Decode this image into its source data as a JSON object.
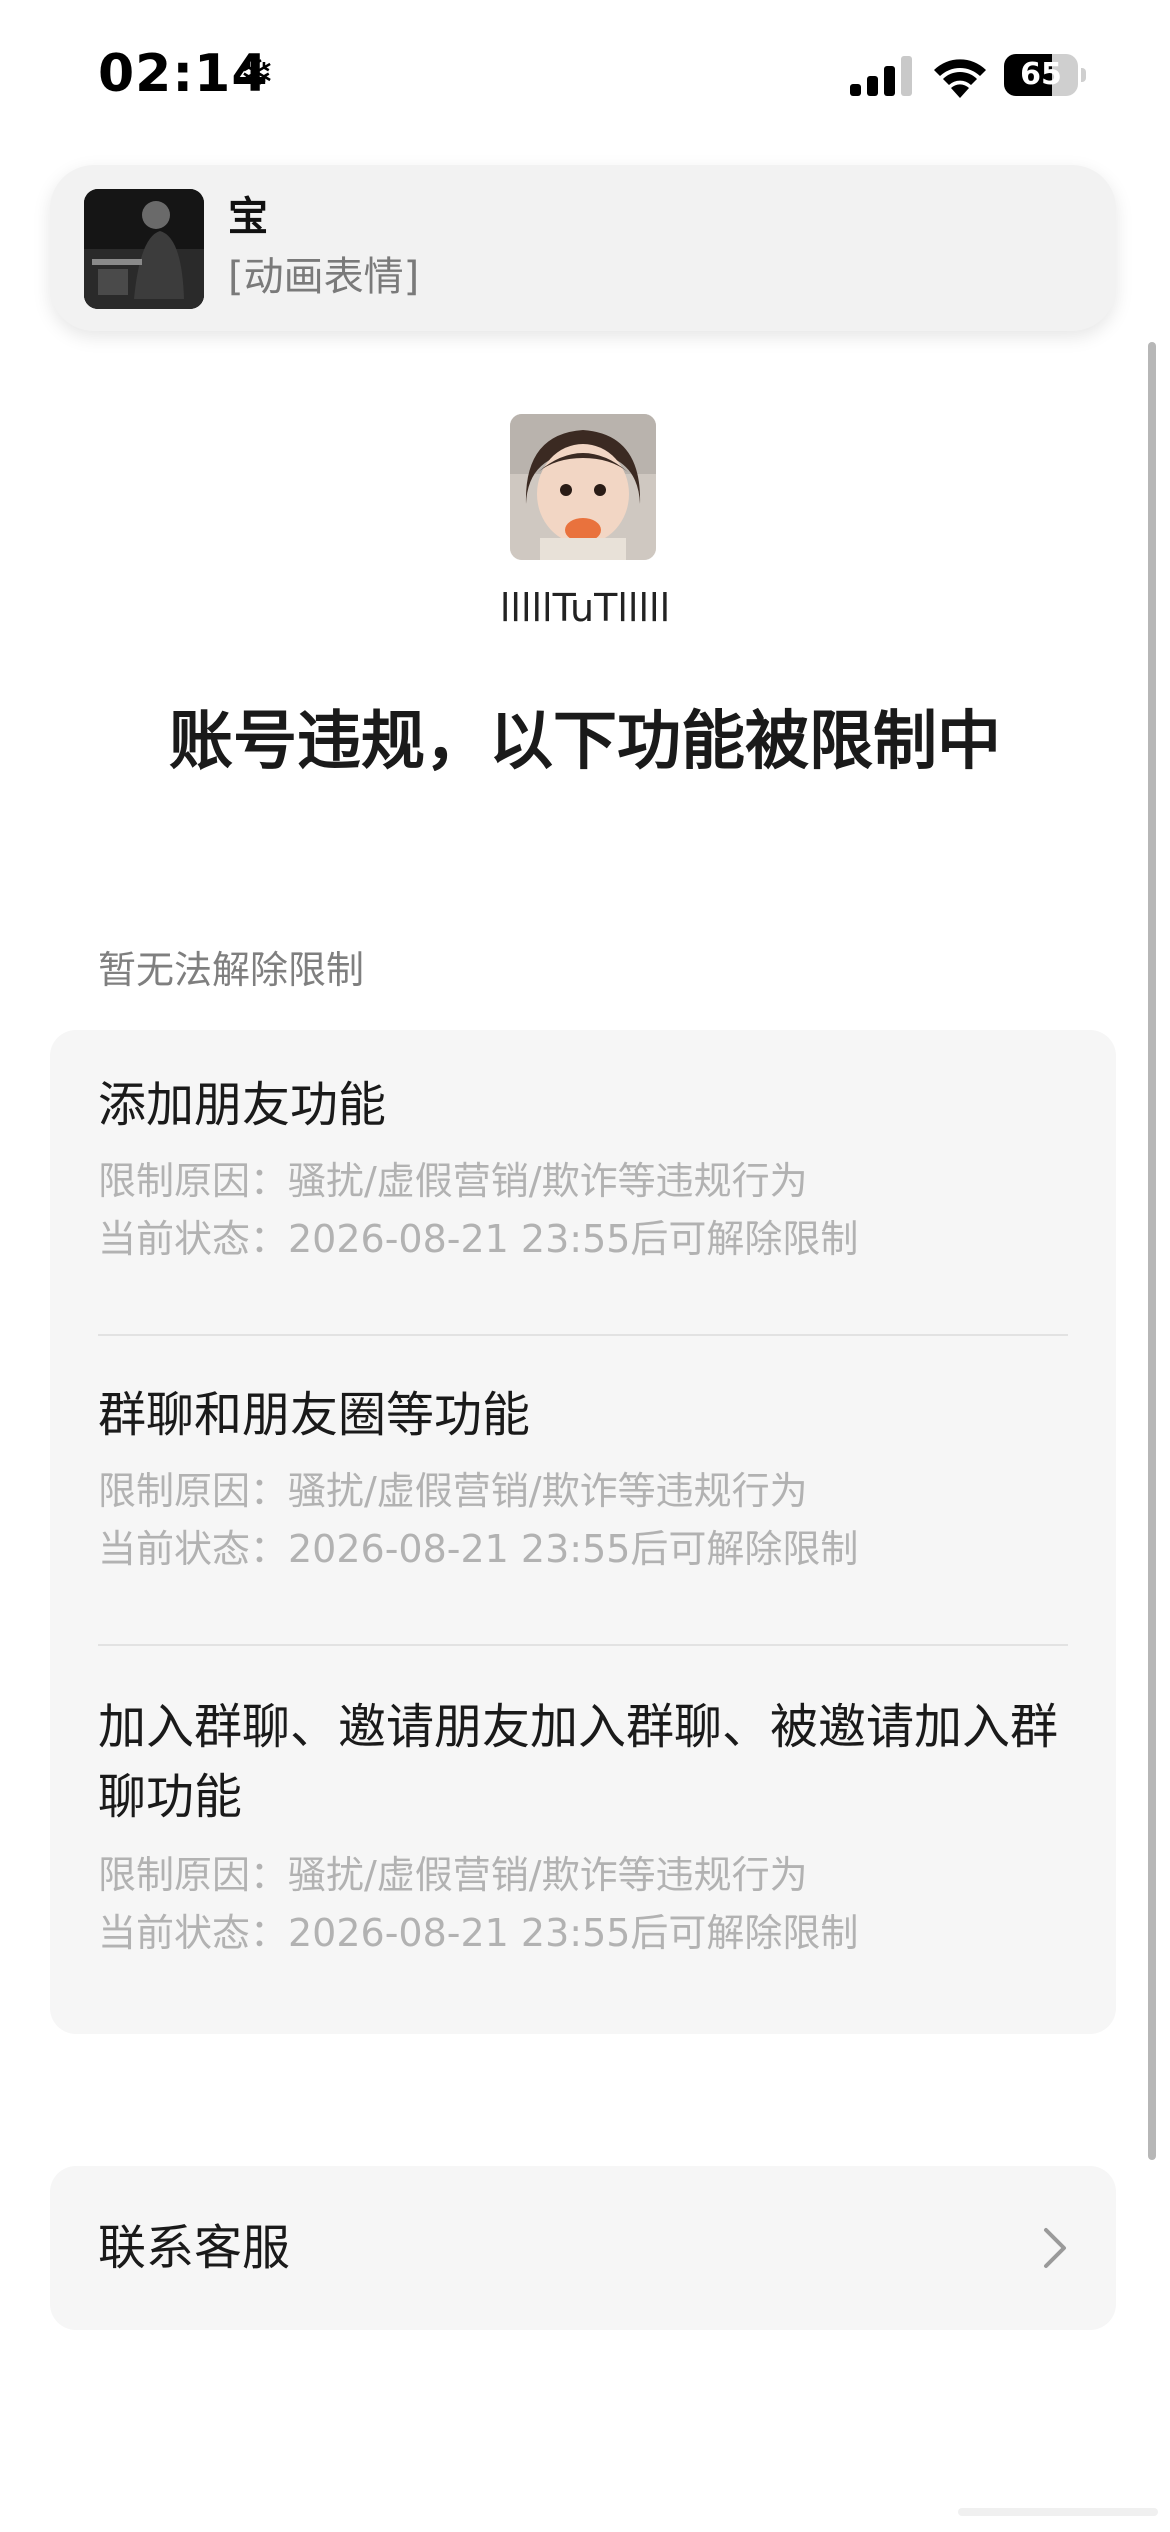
{
  "status_bar": {
    "time": "02:14",
    "focus_icon": "snowflake-icon",
    "battery_percent": "65",
    "battery_level": 0.65
  },
  "notification": {
    "sender": "宝",
    "preview": "[动画表情]",
    "avatar_icon": "contact-avatar"
  },
  "profile": {
    "name": "lllllTuTlllll"
  },
  "page_title": "账号违规，以下功能被限制中",
  "section_header": "暂无法解除限制",
  "restrictions": [
    {
      "title": "添加朋友功能",
      "reason": "限制原因：骚扰/虚假营销/欺诈等违规行为",
      "status": "当前状态：2026-08-21 23:55后可解除限制"
    },
    {
      "title": "群聊和朋友圈等功能",
      "reason": "限制原因：骚扰/虚假营销/欺诈等违规行为",
      "status": "当前状态：2026-08-21 23:55后可解除限制"
    },
    {
      "title": "加入群聊、邀请朋友加入群聊、被邀请加入群聊功能",
      "reason": "限制原因：骚扰/虚假营销/欺诈等违规行为",
      "status": "当前状态：2026-08-21 23:55后可解除限制"
    }
  ],
  "contact_support": {
    "label": "联系客服",
    "icon": "chevron-right-icon"
  },
  "colors": {
    "card_background": "#f6f6f6",
    "secondary_text": "#b2b2b2",
    "primary_text": "#1a1a1a"
  }
}
